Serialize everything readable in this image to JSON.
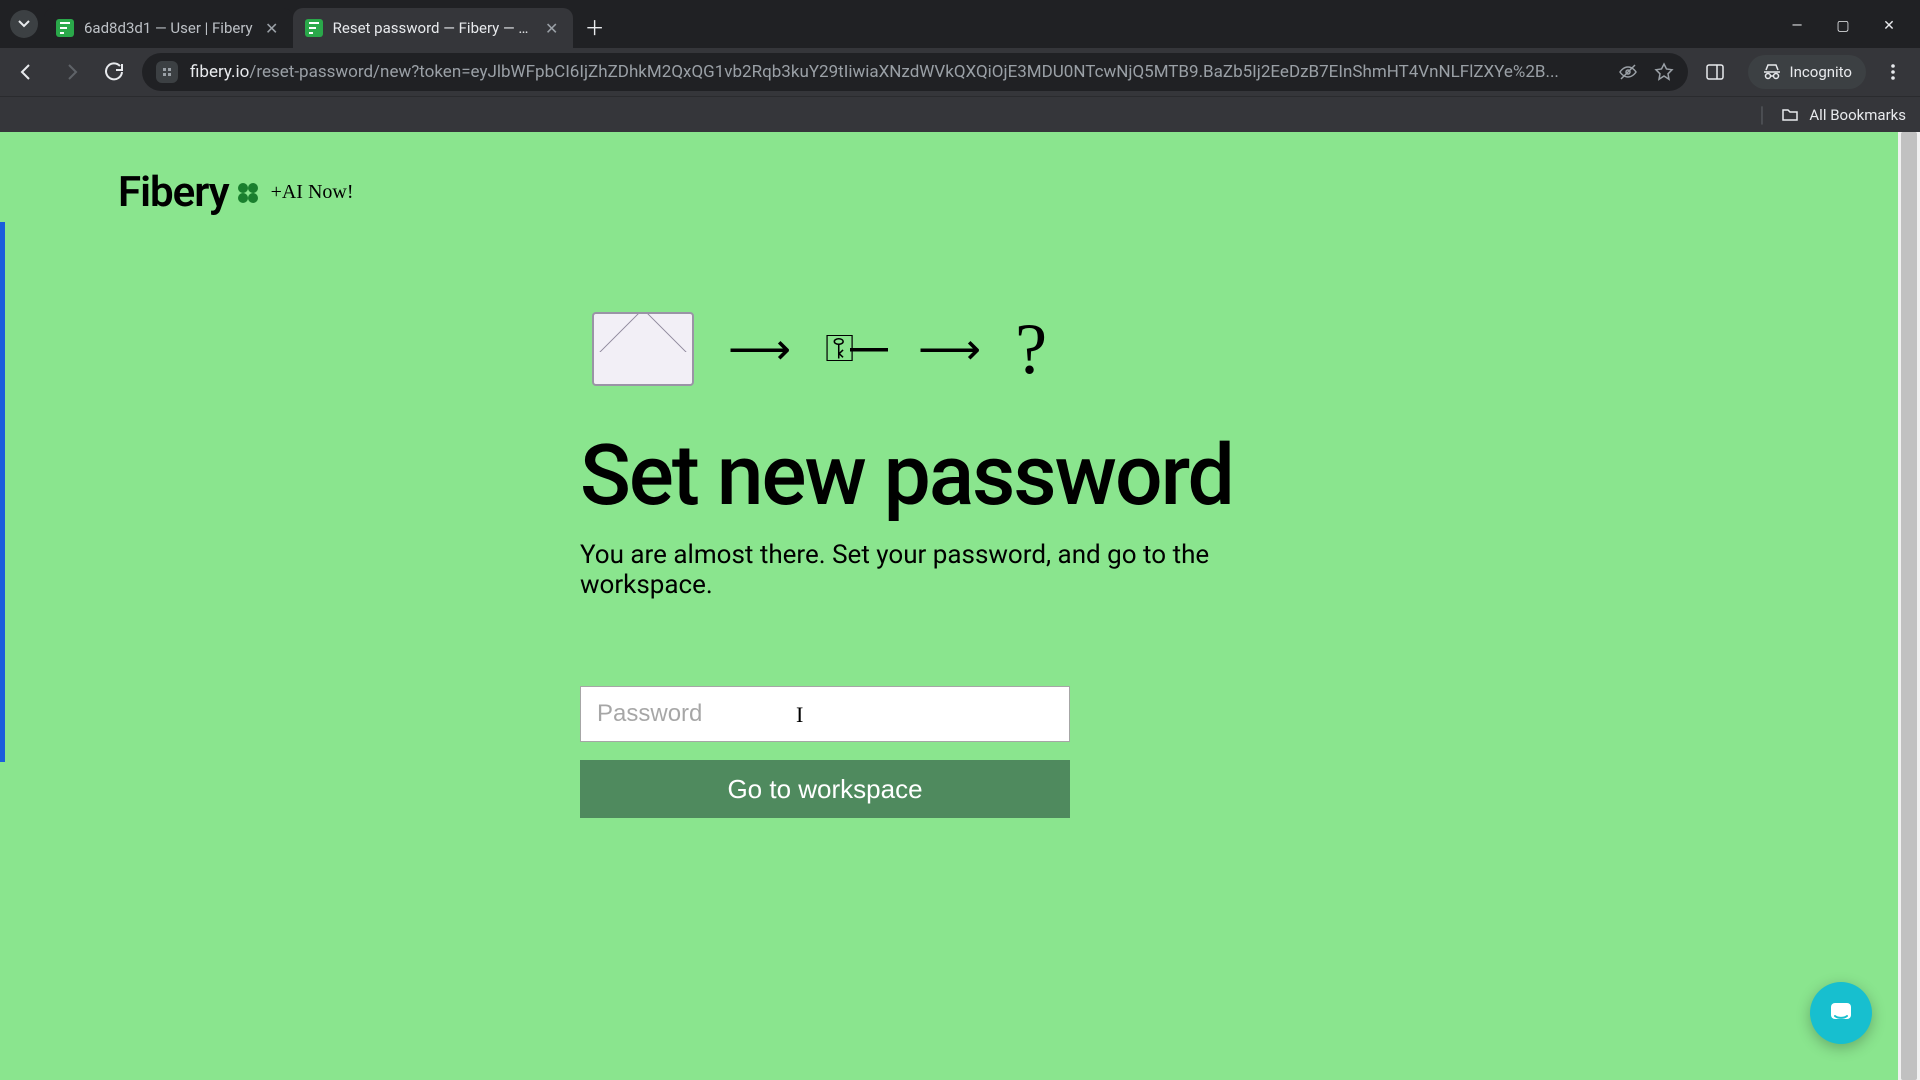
{
  "browser": {
    "tabs": [
      {
        "title": "6ad8d3d1 — User | Fibery",
        "active": false
      },
      {
        "title": "Reset password — Fibery — Fib",
        "active": true
      }
    ],
    "url_host": "fibery.io",
    "url_path": "/reset-password/new?token=eyJlbWFpbCI6IjZhZDhkM2QxQG1vb2Rqb3kuY29tIiwiaXNzdWVkQXQiOjE3MDU0NTcwNjQ5MTB9.BaZb5Ij2EeDzB7EInShmHT4VnNLFlZXYe%2B...",
    "incognito_label": "Incognito",
    "all_bookmarks_label": "All Bookmarks"
  },
  "logo": {
    "word": "Fibery",
    "badge": "+AI Now!"
  },
  "page": {
    "heading": "Set new password",
    "subtext": "You are almost there. Set your password, and go to the workspace.",
    "password_placeholder": "Password",
    "password_value": "",
    "submit_label": "Go to workspace"
  }
}
